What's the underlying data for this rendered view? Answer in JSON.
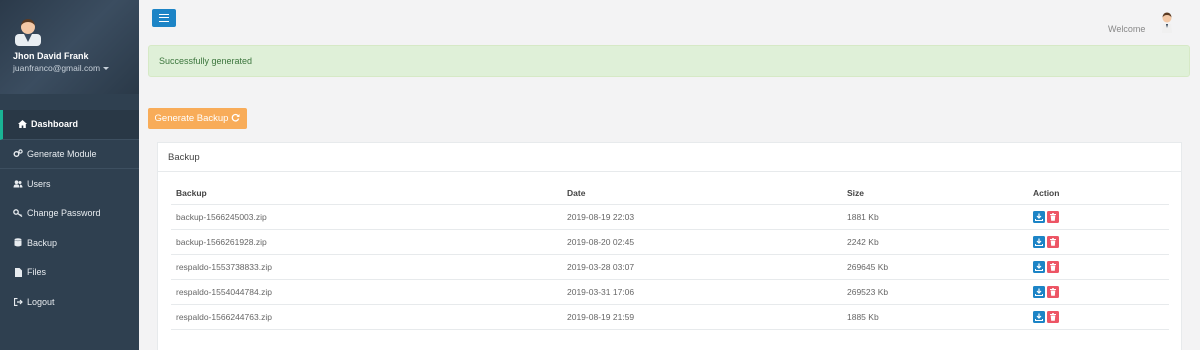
{
  "user": {
    "name": "Jhon David Frank",
    "email": "juanfranco@gmail.com"
  },
  "header": {
    "welcome": "Welcome"
  },
  "alert": {
    "message": "Successfully generated"
  },
  "generate_button": {
    "label": "Generate Backup",
    "icon": "refresh-icon"
  },
  "menu": {
    "items": [
      {
        "label": "Dashboard",
        "icon": "home-icon",
        "active": true
      },
      {
        "label": "Generate Module",
        "icon": "cogs-icon"
      },
      {
        "label": "Users",
        "icon": "users-icon"
      },
      {
        "label": "Change Password",
        "icon": "key-icon"
      },
      {
        "label": "Backup",
        "icon": "database-icon"
      },
      {
        "label": "Files",
        "icon": "file-icon"
      },
      {
        "label": "Logout",
        "icon": "sign-out-icon"
      }
    ]
  },
  "panel": {
    "title": "Backup",
    "columns": [
      "Backup",
      "Date",
      "Size",
      "Action"
    ],
    "rows": [
      [
        "backup-1566245003.zip",
        "2019-08-19 22:03",
        "1881 Kb"
      ],
      [
        "backup-1566261928.zip",
        "2019-08-20 02:45",
        "2242 Kb"
      ],
      [
        "respaldo-1553738833.zip",
        "2019-03-28 03:07",
        "269645 Kb"
      ],
      [
        "respaldo-1554044784.zip",
        "2019-03-31 17:06",
        "269523 Kb"
      ],
      [
        "respaldo-1566244763.zip",
        "2019-08-19 21:59",
        "1885 Kb"
      ]
    ]
  },
  "colors": {
    "sidebar": "#2f4050",
    "primary": "#1c84c6",
    "warning": "#f8ac59",
    "danger": "#ed5565",
    "success_bg": "#dff0d8"
  }
}
